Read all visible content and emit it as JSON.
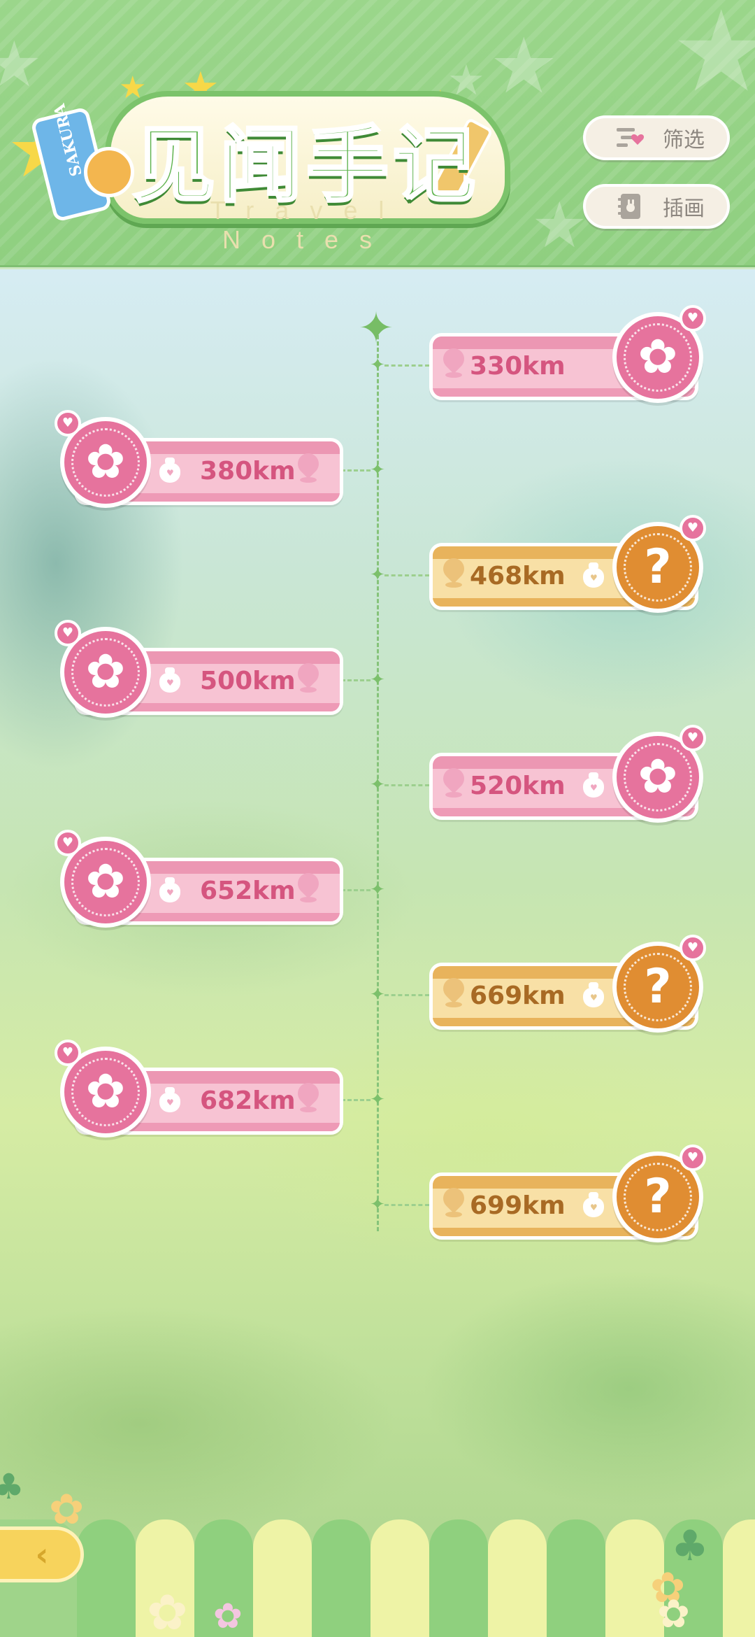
{
  "header": {
    "title": "见闻手记",
    "subtitle": "Travel Notes",
    "tag_text": "SAKURA",
    "buttons": [
      {
        "label": "筛选",
        "icon": "filter-list-heart-icon"
      },
      {
        "label": "插画",
        "icon": "illustration-book-icon"
      }
    ]
  },
  "timeline": {
    "entries": [
      {
        "distance": "330km",
        "state": "unlocked",
        "side": "right",
        "icon": "sakura-flower-icon"
      },
      {
        "distance": "380km",
        "state": "unlocked",
        "side": "left",
        "icon": "sakura-flower-icon"
      },
      {
        "distance": "468km",
        "state": "locked",
        "side": "right",
        "icon": "question-mark-icon"
      },
      {
        "distance": "500km",
        "state": "unlocked",
        "side": "left",
        "icon": "sakura-flower-icon"
      },
      {
        "distance": "520km",
        "state": "unlocked",
        "side": "right",
        "icon": "sakura-flower-icon"
      },
      {
        "distance": "652km",
        "state": "unlocked",
        "side": "left",
        "icon": "sakura-flower-icon"
      },
      {
        "distance": "669km",
        "state": "locked",
        "side": "right",
        "icon": "question-mark-icon"
      },
      {
        "distance": "682km",
        "state": "unlocked",
        "side": "left",
        "icon": "sakura-flower-icon"
      },
      {
        "distance": "699km",
        "state": "locked",
        "side": "right",
        "icon": "question-mark-icon"
      }
    ]
  },
  "glyphs": {
    "sakura": "✿",
    "question": "?",
    "heart": "♥",
    "sparkle": "✦",
    "back": "‹"
  },
  "colors": {
    "header_green": "#8fcf80",
    "unlocked_pink": "#e6739d",
    "locked_orange": "#e08d32",
    "timeline_green": "#86c37a",
    "back_button_yellow": "#f7d35c"
  },
  "footer": {
    "back_button": {
      "icon": "back-arrow-icon"
    }
  }
}
